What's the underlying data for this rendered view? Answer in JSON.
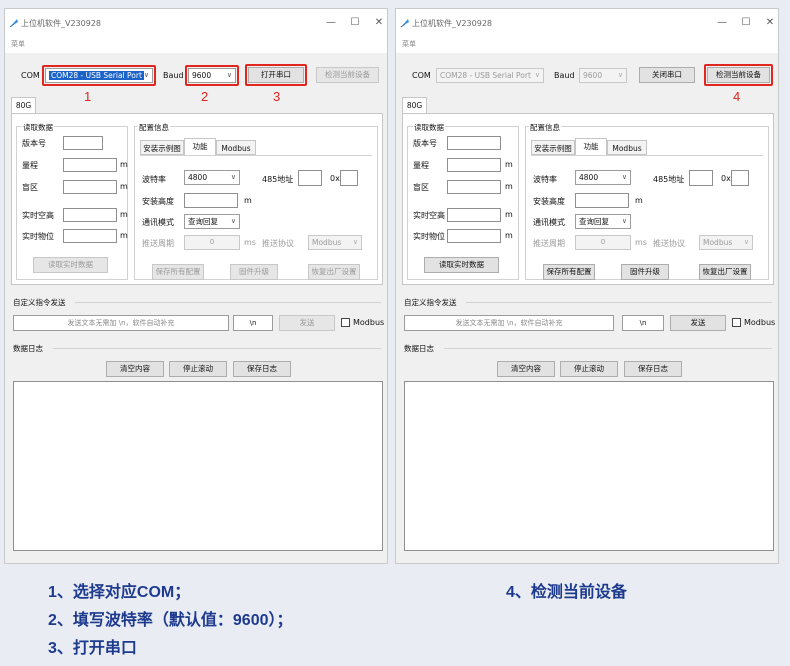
{
  "app": {
    "title": "上位机软件_V230928",
    "menu": "菜单",
    "colors": {
      "accent_red": "#e0261f",
      "caption_blue": "#1e3a8f",
      "selection_blue": "#1c63c9"
    }
  },
  "window_controls": {
    "minimize": "—",
    "maximize": "☐",
    "close": "✕"
  },
  "labels": {
    "com": "COM",
    "baud": "Baud",
    "tab_80g": "80G",
    "read_group": "读取数据",
    "version": "版本号",
    "range": "量程",
    "blind": "盲区",
    "air_height": "实时空高",
    "level": "实时物位",
    "unit_m": "m",
    "config_group": "配置信息",
    "tab_example": "安装示例图",
    "tab_function": "功能",
    "tab_modbus": "Modbus",
    "baud_rate": "波特率",
    "addr485": "485地址",
    "hex_prefix": "0x",
    "install_height": "安装高度",
    "comm_mode": "通讯模式",
    "push_period": "推送周期",
    "ms": "ms",
    "push_protocol": "推送协议",
    "custom_cmd": "自定义指令发送",
    "modbus_check": "Modbus",
    "data_log": "数据日志"
  },
  "window1": {
    "com_value": "COM28 - USB Serial Port",
    "baud_value": "9600",
    "open_button": "打开串口",
    "detect_button": "检测当前设备",
    "read_button": "读取实时数据",
    "baud_rate_value": "4800",
    "comm_mode_value": "查询回复",
    "push_period_value": "0",
    "push_protocol_value": "Modbus",
    "save_cfg_button": "保存所有配置",
    "firmware_button": "固件升级",
    "factory_button": "恢复出厂设置",
    "send_placeholder": "发送文本无需加 \\n，软件自动补充",
    "newline_value": "\\n",
    "send_button": "发送",
    "clear_button": "清空内容",
    "stop_scroll_button": "停止滚动",
    "save_log_button": "保存日志"
  },
  "window2": {
    "com_value": "COM28 - USB Serial Port",
    "baud_value": "9600",
    "close_button": "关闭串口",
    "detect_button": "检测当前设备",
    "read_button": "读取实时数据",
    "baud_rate_value": "4800",
    "comm_mode_value": "查询回复",
    "push_period_value": "0",
    "push_protocol_value": "Modbus",
    "save_cfg_button": "保存所有配置",
    "firmware_button": "固件升级",
    "factory_button": "恢复出厂设置",
    "send_placeholder": "发送文本无需加 \\n，软件自动补充",
    "newline_value": "\\n",
    "send_button": "发送",
    "clear_button": "清空内容",
    "stop_scroll_button": "停止滚动",
    "save_log_button": "保存日志"
  },
  "annotations": {
    "n1": "1",
    "n2": "2",
    "n3": "3",
    "n4": "4"
  },
  "captions": {
    "step1": "1、选择对应COM；",
    "step2": "2、填写波特率（默认值：9600）；",
    "step3": "3、打开串口",
    "step4": "4、检测当前设备"
  }
}
